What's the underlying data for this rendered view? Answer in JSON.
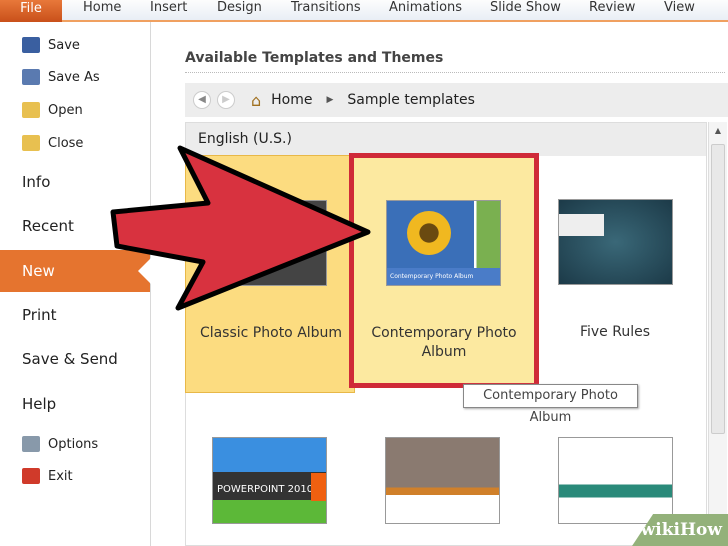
{
  "ribbon": {
    "file": "File",
    "tabs": [
      "Home",
      "Insert",
      "Design",
      "Transitions",
      "Animations",
      "Slide Show",
      "Review",
      "View"
    ]
  },
  "sidebar": {
    "items": [
      {
        "label": "Save",
        "icon": "save-icon",
        "color": "#3a5fa0"
      },
      {
        "label": "Save As",
        "icon": "save-as-icon",
        "color": "#5a7ab0"
      },
      {
        "label": "Open",
        "icon": "open-folder-icon",
        "color": "#e8c050"
      },
      {
        "label": "Close",
        "icon": "close-folder-icon",
        "color": "#e8c050"
      },
      {
        "label": "Info"
      },
      {
        "label": "Recent"
      },
      {
        "label": "New",
        "selected": true
      },
      {
        "label": "Print"
      },
      {
        "label": "Save & Send"
      },
      {
        "label": "Help"
      },
      {
        "label": "Options",
        "icon": "options-icon",
        "color": "#8899aa"
      },
      {
        "label": "Exit",
        "icon": "exit-icon",
        "color": "#d03a2a"
      }
    ]
  },
  "main": {
    "title": "Available Templates and Themes",
    "breadcrumb": {
      "home": "Home",
      "current": "Sample templates"
    },
    "group": "English (U.S.)",
    "templates": [
      {
        "label": "Classic Photo Album",
        "state": "hover"
      },
      {
        "label": "Contemporary Photo Album",
        "state": "selected",
        "thumb_text": "Contemporary Photo Album"
      },
      {
        "label": "Five Rules"
      },
      {
        "thumb_text": "POWERPOINT 2010"
      },
      {},
      {}
    ],
    "tooltip": "Contemporary Photo Album"
  },
  "colors": {
    "accent": "#e5742f",
    "highlight": "#fde08a",
    "annotation": "#d8323f"
  },
  "watermark": "wikiHow"
}
